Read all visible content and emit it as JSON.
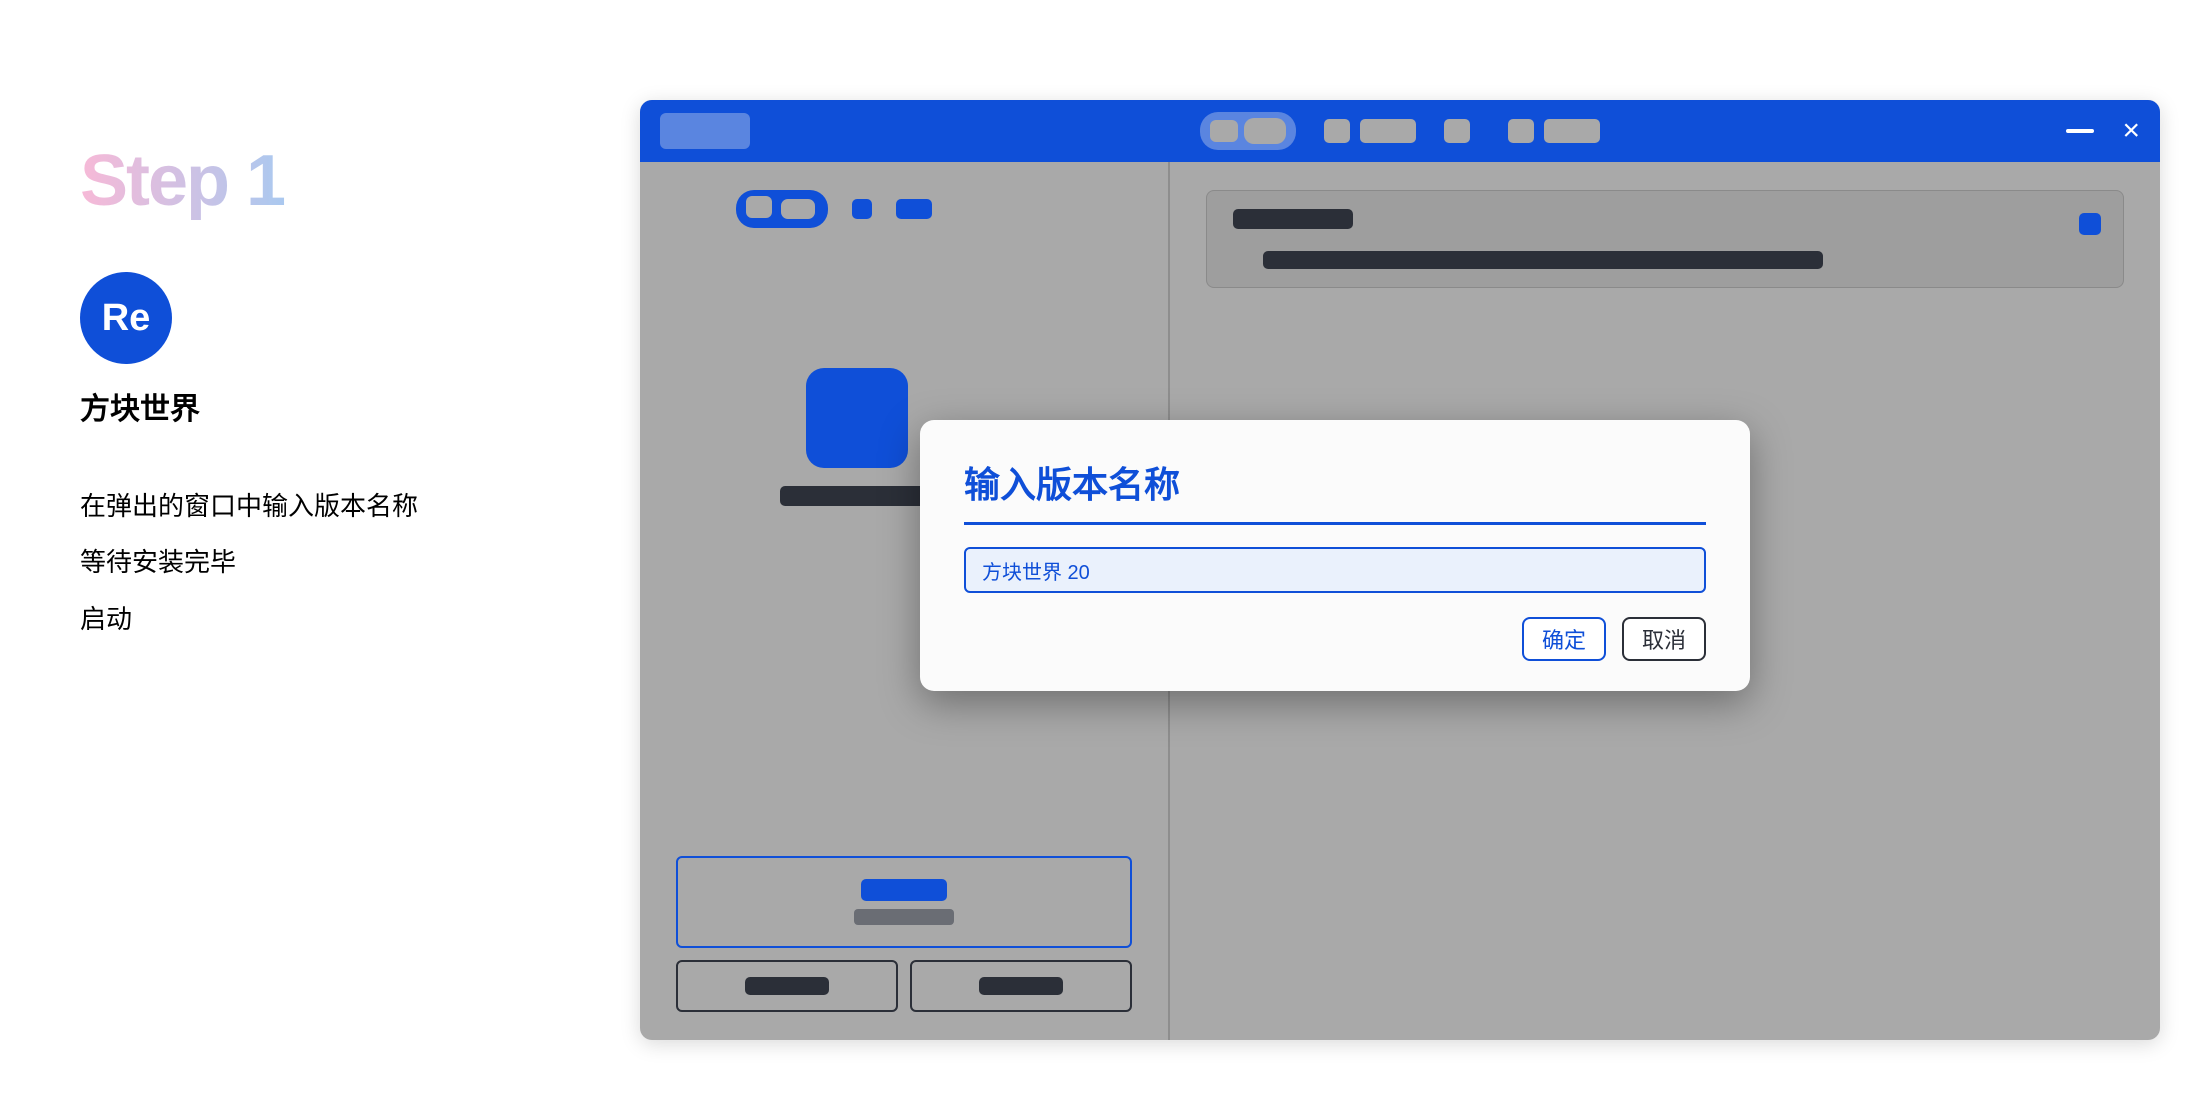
{
  "left": {
    "step_label": "Step 1",
    "badge_text": "Re",
    "app_name": "方块世界",
    "instructions": [
      "在弹出的窗口中输入版本名称",
      "等待安装完毕",
      "启动"
    ]
  },
  "window": {
    "minimize_label": "−",
    "close_label": "×"
  },
  "modal": {
    "title": "输入版本名称",
    "input_value": "方块世界 20",
    "ok_label": "确定",
    "cancel_label": "取消"
  }
}
